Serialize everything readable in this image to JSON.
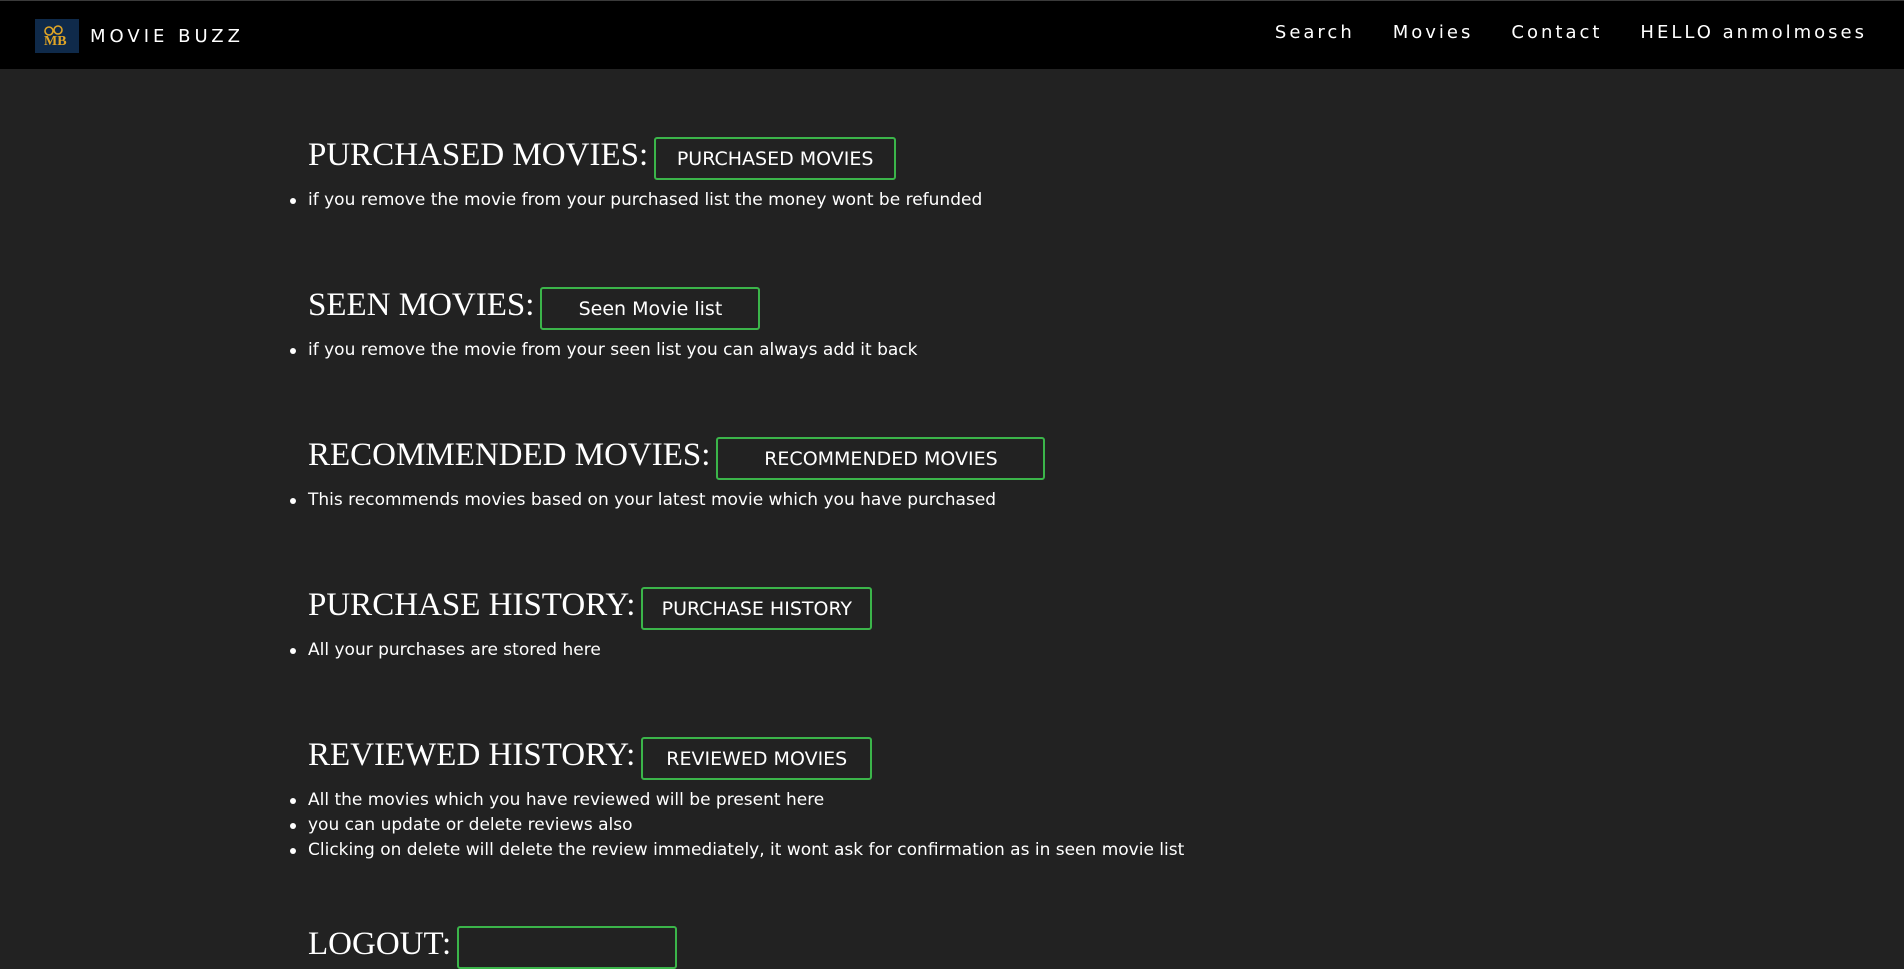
{
  "navbar": {
    "brand": "MOVIE BUZZ",
    "logo_icon": "mb-logo-icon",
    "links": [
      "Search",
      "Movies",
      "Contact",
      "HELLO anmolmoses"
    ]
  },
  "sections": [
    {
      "heading": "PURCHASED MOVIES:",
      "button": "PURCHASED MOVIES",
      "notes": [
        "if you remove the movie from your purchased list the money wont be refunded"
      ]
    },
    {
      "heading": "SEEN MOVIES:",
      "button": "Seen Movie list",
      "notes": [
        "if you remove the movie from your seen list you can always add it back"
      ]
    },
    {
      "heading": "RECOMMENDED MOVIES:",
      "button": "RECOMMENDED MOVIES",
      "notes": [
        "This recommends movies based on your latest movie which you have purchased"
      ]
    },
    {
      "heading": "PURCHASE HISTORY:",
      "button": "PURCHASE HISTORY",
      "notes": [
        "All your purchases are stored here"
      ]
    },
    {
      "heading": "REVIEWED HISTORY:",
      "button": "REVIEWED MOVIES",
      "notes": [
        "All the movies which you have reviewed will be present here",
        "you can update or delete reviews also",
        "Clicking on delete will delete the review immediately, it wont ask for confirmation as in seen movie list"
      ]
    },
    {
      "heading": "LOGOUT:",
      "button": "",
      "notes": []
    }
  ],
  "colors": {
    "background": "#222222",
    "navbar": "#000000",
    "button_border": "#3bb54a",
    "logo_bg": "#0f2a4a",
    "logo_accent": "#e0a526"
  }
}
